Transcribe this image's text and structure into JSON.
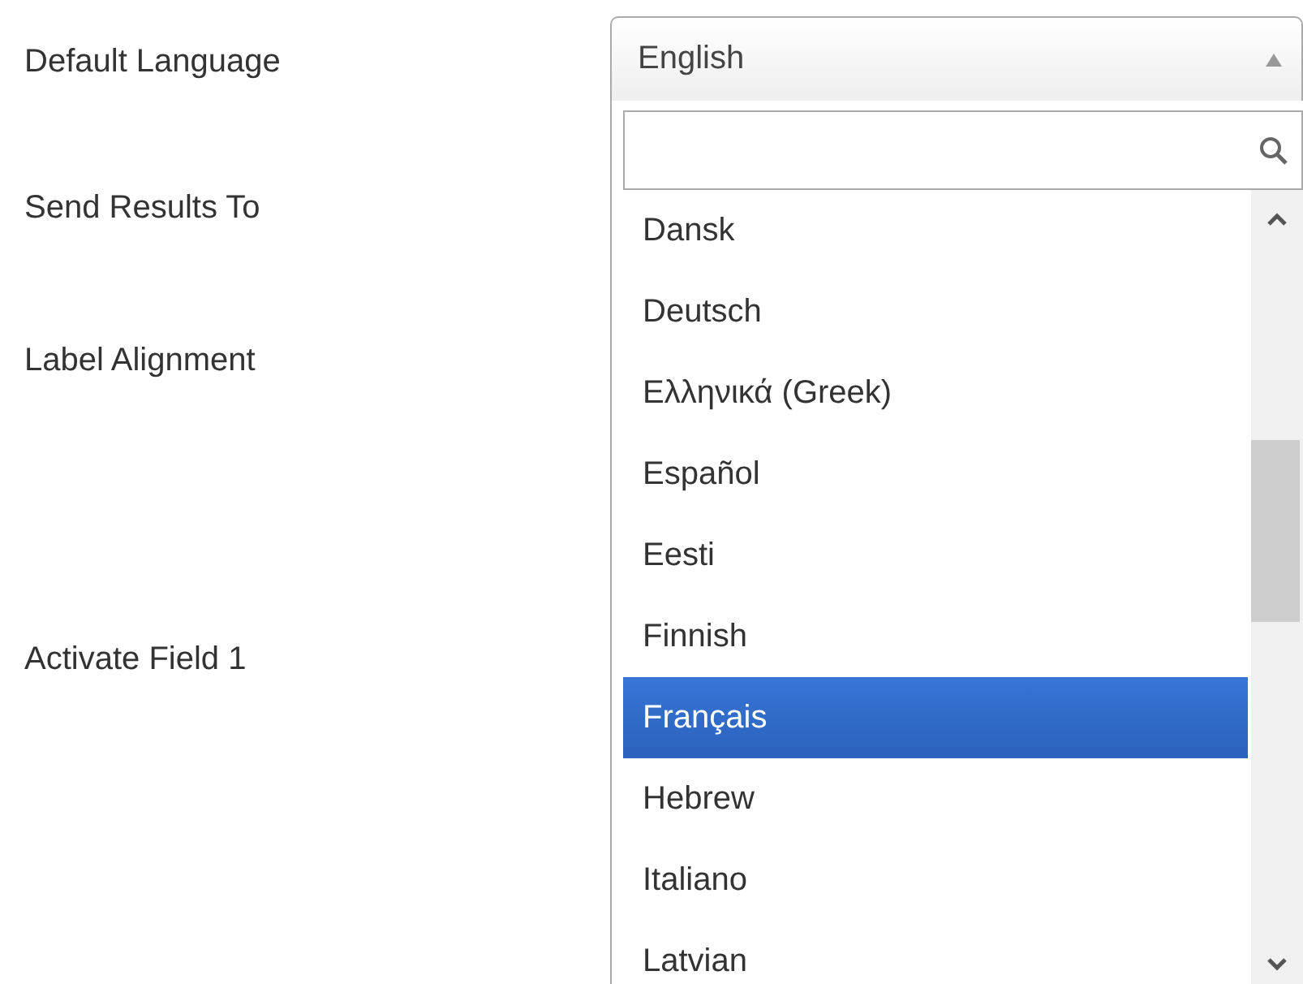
{
  "form_labels": [
    "Default Language",
    "Send Results To",
    "Label Alignment",
    "Activate Field 1"
  ],
  "language_select": {
    "value": "English",
    "expanded": true,
    "options": [
      {
        "label": "Dansk",
        "selected": false
      },
      {
        "label": "Deutsch",
        "selected": false
      },
      {
        "label": "Ελληνικά (Greek)",
        "selected": false
      },
      {
        "label": "Español",
        "selected": false
      },
      {
        "label": "Eesti",
        "selected": false
      },
      {
        "label": "Finnish",
        "selected": false
      },
      {
        "label": "Français",
        "selected": true
      },
      {
        "label": "Hebrew",
        "selected": false
      },
      {
        "label": "Italiano",
        "selected": false
      },
      {
        "label": "Latvian",
        "selected": false
      }
    ]
  }
}
